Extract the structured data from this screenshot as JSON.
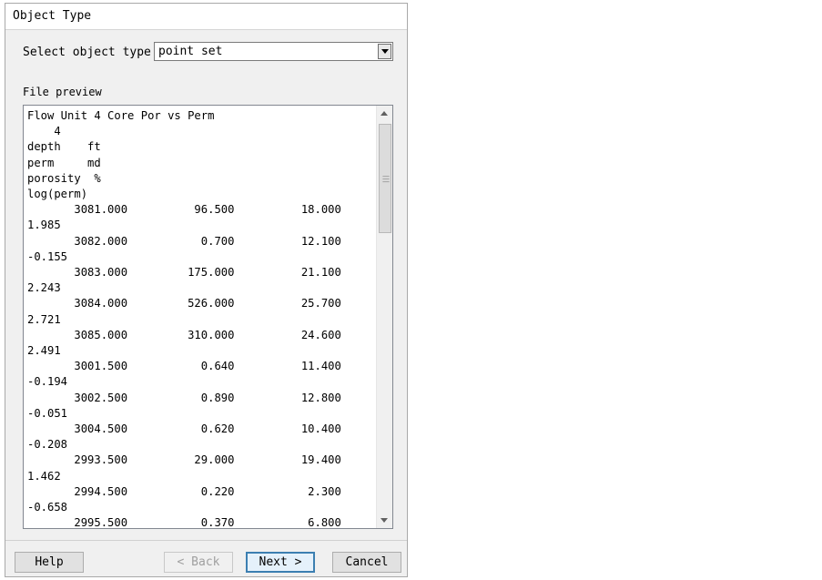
{
  "window": {
    "title": "Object Type"
  },
  "object_type": {
    "label": "Select object type",
    "value": "point set"
  },
  "preview": {
    "label": "File preview",
    "lines": [
      "Flow Unit 4 Core Por vs Perm",
      "    4",
      "depth    ft",
      "perm     md",
      "porosity  %",
      "log(perm)",
      "       3081.000          96.500          18.000",
      "1.985",
      "       3082.000           0.700          12.100",
      "-0.155",
      "       3083.000         175.000          21.100",
      "2.243",
      "       3084.000         526.000          25.700",
      "2.721",
      "       3085.000         310.000          24.600",
      "2.491",
      "       3001.500           0.640          11.400",
      "-0.194",
      "       3002.500           0.890          12.800",
      "-0.051",
      "       3004.500           0.620          10.400",
      "-0.208",
      "       2993.500          29.000          19.400",
      "1.462",
      "       2994.500           0.220           2.300",
      "-0.658",
      "       2995.500           0.370           6.800"
    ]
  },
  "buttons": {
    "help": "Help",
    "back": "< Back",
    "next": "Next >",
    "cancel": "Cancel"
  }
}
